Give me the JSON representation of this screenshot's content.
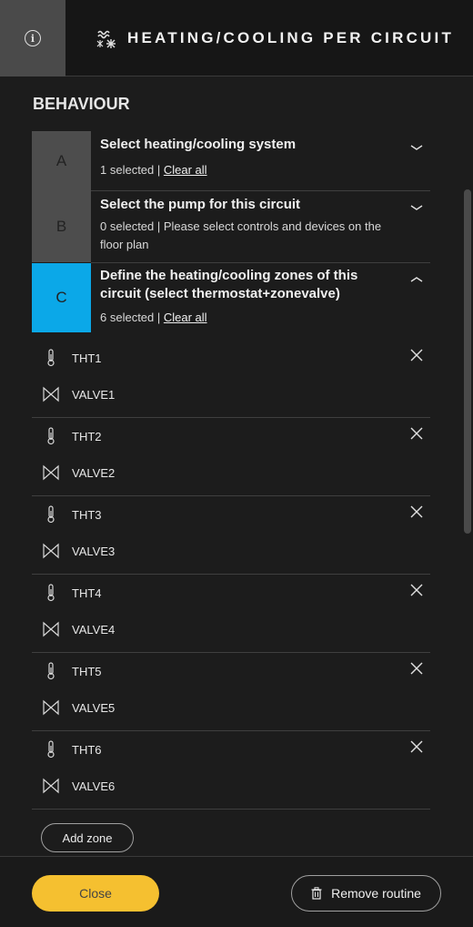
{
  "header": {
    "info_icon": "info-icon",
    "system_icon": "heating-cooling-icon",
    "title": "HEATING/COOLING PER CIRCUIT"
  },
  "section": {
    "title": "BEHAVIOUR"
  },
  "steps": [
    {
      "badge": "A",
      "title": "Select heating/cooling system",
      "status": "1 selected | ",
      "link": "Clear all",
      "expanded": false
    },
    {
      "badge": "B",
      "title": "Select the pump for this circuit",
      "status": "0 selected | Please select controls and devices on the floor plan",
      "link": "",
      "expanded": false
    },
    {
      "badge": "C",
      "title": "Define the heating/cooling zones of this circuit (select thermostat+zonevalve)",
      "status": "6 selected | ",
      "link": "Clear all",
      "expanded": true
    }
  ],
  "zones": [
    {
      "thermostat": "THT1",
      "valve": "VALVE1"
    },
    {
      "thermostat": "THT2",
      "valve": "VALVE2"
    },
    {
      "thermostat": "THT3",
      "valve": "VALVE3"
    },
    {
      "thermostat": "THT4",
      "valve": "VALVE4"
    },
    {
      "thermostat": "THT5",
      "valve": "VALVE5"
    },
    {
      "thermostat": "THT6",
      "valve": "VALVE6"
    }
  ],
  "add_zone_label": "Add zone",
  "footer": {
    "close_label": "Close",
    "remove_label": "Remove routine"
  },
  "colors": {
    "active_step": "#0ba8e8",
    "inactive_step": "#4d4d4d",
    "primary_button": "#f5c030",
    "background": "#1c1c1c"
  }
}
